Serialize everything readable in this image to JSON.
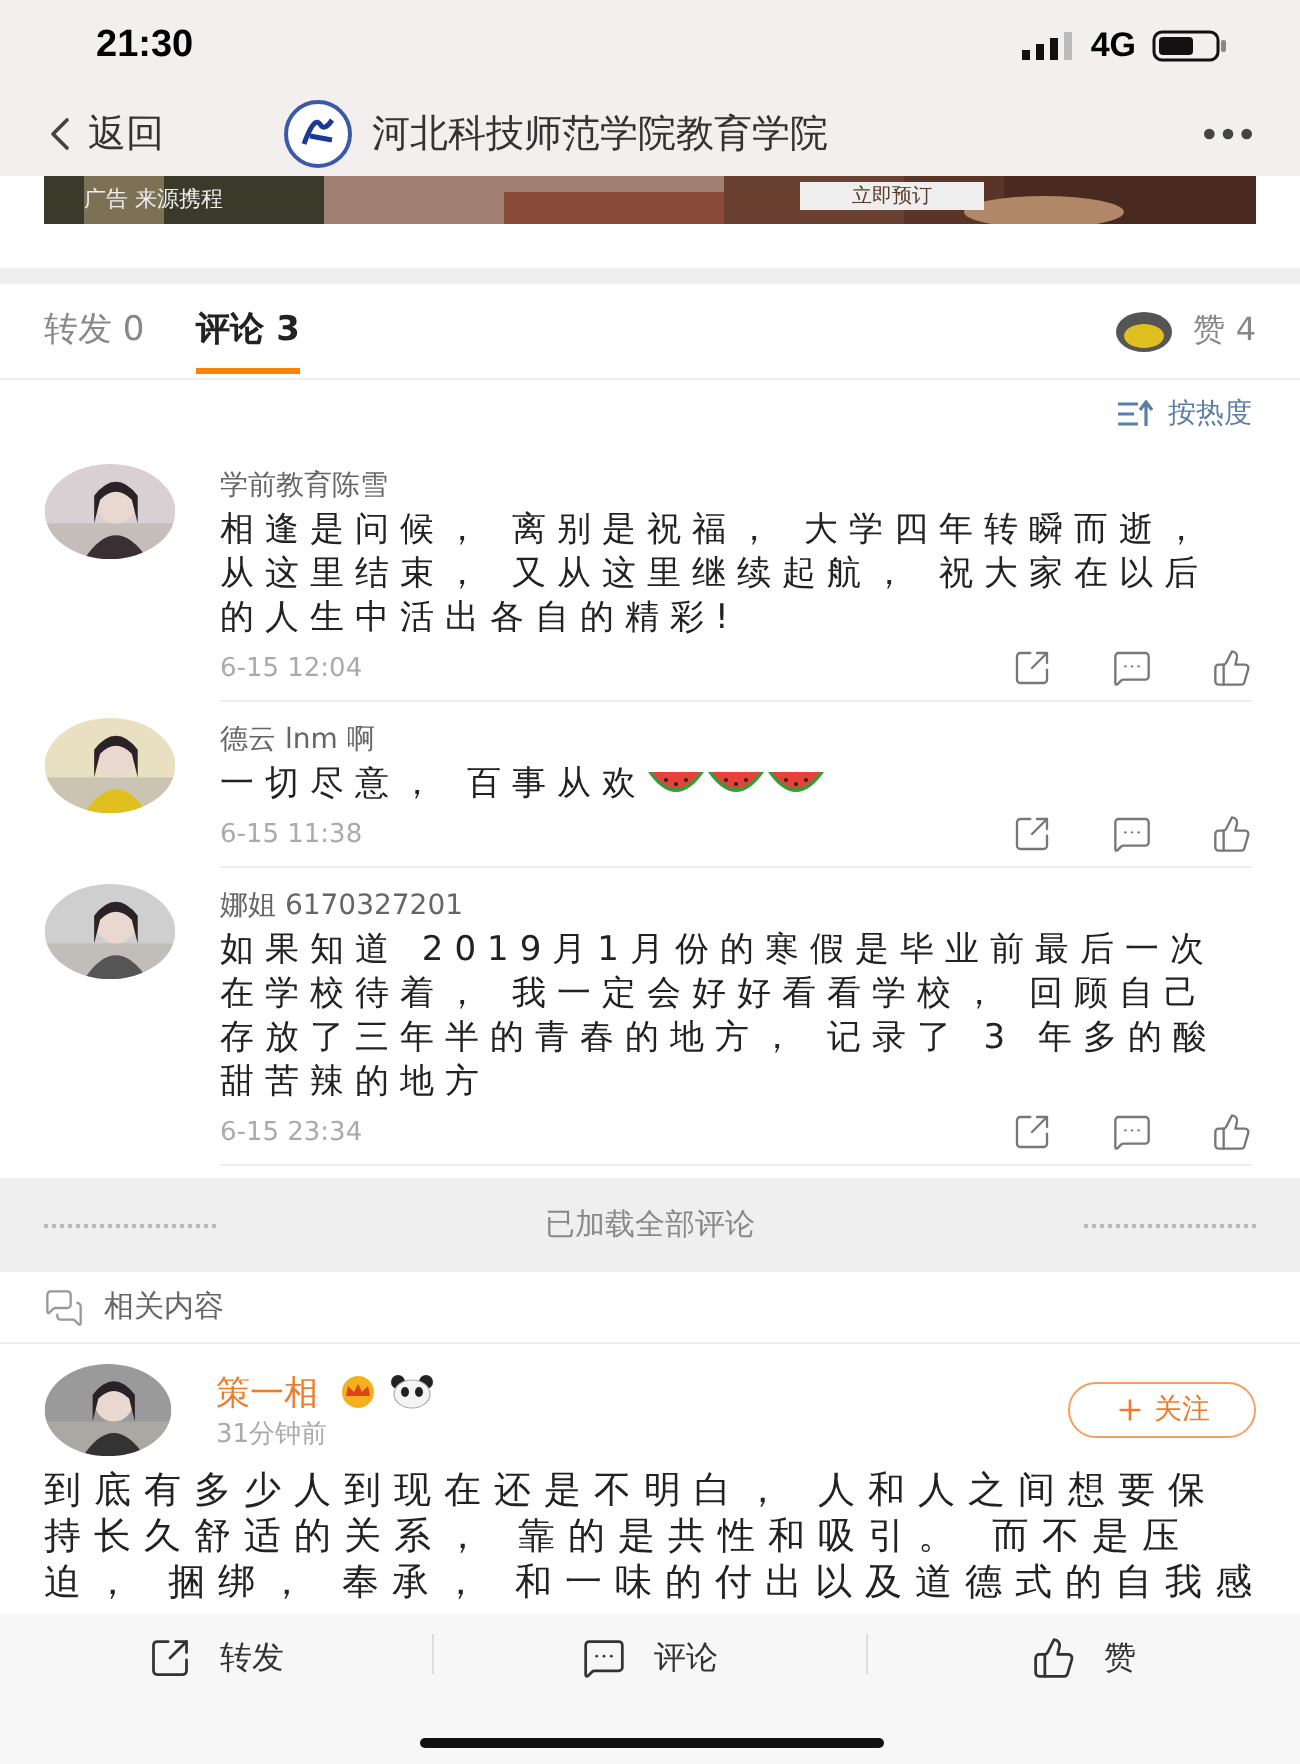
{
  "status_bar": {
    "time": "21:30",
    "network": "4G"
  },
  "nav": {
    "back": "返回",
    "title": "河北科技师范学院教育学院"
  },
  "ad": {
    "tag": "广告",
    "source": "来源携程",
    "button": "立即预订"
  },
  "tabs": [
    {
      "label": "转发 0",
      "selected": false
    },
    {
      "label": "评论 3",
      "selected": true
    }
  ],
  "likes": "赞 4",
  "sort": "按热度",
  "comments": [
    {
      "user": "学前教育陈雪",
      "lines": [
        "相逢是问候， 离别是祝福， 大学四年转瞬而逝，",
        "从这里结束， 又从这里继续起航， 祝大家在以后",
        "的人生中活出各自的精彩!"
      ],
      "time": "6-15 12:04"
    },
    {
      "user": "德云 lnm 啊",
      "lines": [
        "一切尽意， 百事从欢"
      ],
      "time": "6-15 11:38",
      "emojis": [
        {
          "kind": "watermelon"
        },
        {
          "kind": "watermelon"
        },
        {
          "kind": "watermelon"
        }
      ]
    },
    {
      "user": "娜姐 6170327201",
      "lines": [
        "如果知道 2019月1月份的寒假是毕业前最后一次",
        "在学校待着， 我一定会好好看看学校， 回顾自己",
        "存放了三年半的青春的地方， 记录了 3 年多的酸",
        "甜苦辣的地方"
      ],
      "time": "6-15 23:34"
    }
  ],
  "loaded_all": "已加载全部评论",
  "related": {
    "title": "相关内容"
  },
  "post": {
    "author": "策一相",
    "time": "31分钟前",
    "follow": "关注",
    "lines": [
      "到底有多少人到现在还是不明白， 人和人之间想要保",
      "持长久舒适的关系， 靠的是共性和吸引。 而不是压",
      "迫， 捆绑， 奉承， 和一味的付出以及道德式的自我感"
    ]
  },
  "toolbar": [
    "转发",
    "评论",
    "赞"
  ]
}
